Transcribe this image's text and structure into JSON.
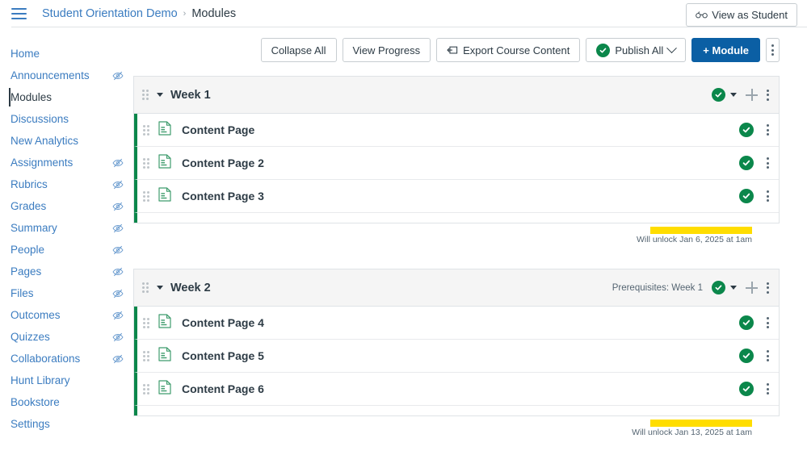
{
  "header": {
    "menu_icon": "hamburger-icon",
    "breadcrumb": {
      "course": "Student Orientation Demo",
      "separator": "›",
      "current": "Modules"
    },
    "view_as_student": {
      "label": "View as Student",
      "icon": "eyeglasses-icon"
    }
  },
  "sidebar": {
    "items": [
      {
        "label": "Home",
        "hidden_icon": false,
        "active": false
      },
      {
        "label": "Announcements",
        "hidden_icon": true,
        "active": false
      },
      {
        "label": "Modules",
        "hidden_icon": false,
        "active": true
      },
      {
        "label": "Discussions",
        "hidden_icon": false,
        "active": false
      },
      {
        "label": "New Analytics",
        "hidden_icon": false,
        "active": false
      },
      {
        "label": "Assignments",
        "hidden_icon": true,
        "active": false
      },
      {
        "label": "Rubrics",
        "hidden_icon": true,
        "active": false
      },
      {
        "label": "Grades",
        "hidden_icon": true,
        "active": false
      },
      {
        "label": "Summary",
        "hidden_icon": true,
        "active": false
      },
      {
        "label": "People",
        "hidden_icon": true,
        "active": false
      },
      {
        "label": "Pages",
        "hidden_icon": true,
        "active": false
      },
      {
        "label": "Files",
        "hidden_icon": true,
        "active": false
      },
      {
        "label": "Outcomes",
        "hidden_icon": true,
        "active": false
      },
      {
        "label": "Quizzes",
        "hidden_icon": true,
        "active": false
      },
      {
        "label": "Collaborations",
        "hidden_icon": true,
        "active": false
      },
      {
        "label": "Hunt Library",
        "hidden_icon": false,
        "active": false
      },
      {
        "label": "Bookstore",
        "hidden_icon": false,
        "active": false
      },
      {
        "label": "Settings",
        "hidden_icon": false,
        "active": false
      }
    ]
  },
  "toolbar": {
    "collapse_all": "Collapse All",
    "view_progress": "View Progress",
    "export_course_content": "Export Course Content",
    "export_icon": "export-icon",
    "publish_all": "Publish All",
    "publish_all_icon": "published-check-icon",
    "add_module": "+ Module",
    "more_icon": "kebab-menu-icon"
  },
  "colors": {
    "brand_blue": "#0b5fa4",
    "link_blue": "#3b7cc0",
    "published_green": "#0b874b",
    "highlight_yellow": "#ffdd00",
    "text_dark": "#2D3B45",
    "module_header_bg": "#f5f5f5",
    "border": "#dfe3e6"
  },
  "modules": [
    {
      "title": "Week 1",
      "prerequisites": "",
      "published": true,
      "items": [
        {
          "title": "Content Page",
          "type_icon": "page-icon",
          "published": true
        },
        {
          "title": "Content Page 2",
          "type_icon": "page-icon",
          "published": true
        },
        {
          "title": "Content Page 3",
          "type_icon": "page-icon",
          "published": true
        }
      ],
      "unlock_text": "Will unlock Jan 6, 2025 at 1am"
    },
    {
      "title": "Week 2",
      "prerequisites": "Prerequisites: Week 1",
      "published": true,
      "items": [
        {
          "title": "Content Page 4",
          "type_icon": "page-icon",
          "published": true
        },
        {
          "title": "Content Page 5",
          "type_icon": "page-icon",
          "published": true
        },
        {
          "title": "Content Page 6",
          "type_icon": "page-icon",
          "published": true
        }
      ],
      "unlock_text": "Will unlock Jan 13, 2025 at 1am"
    }
  ]
}
